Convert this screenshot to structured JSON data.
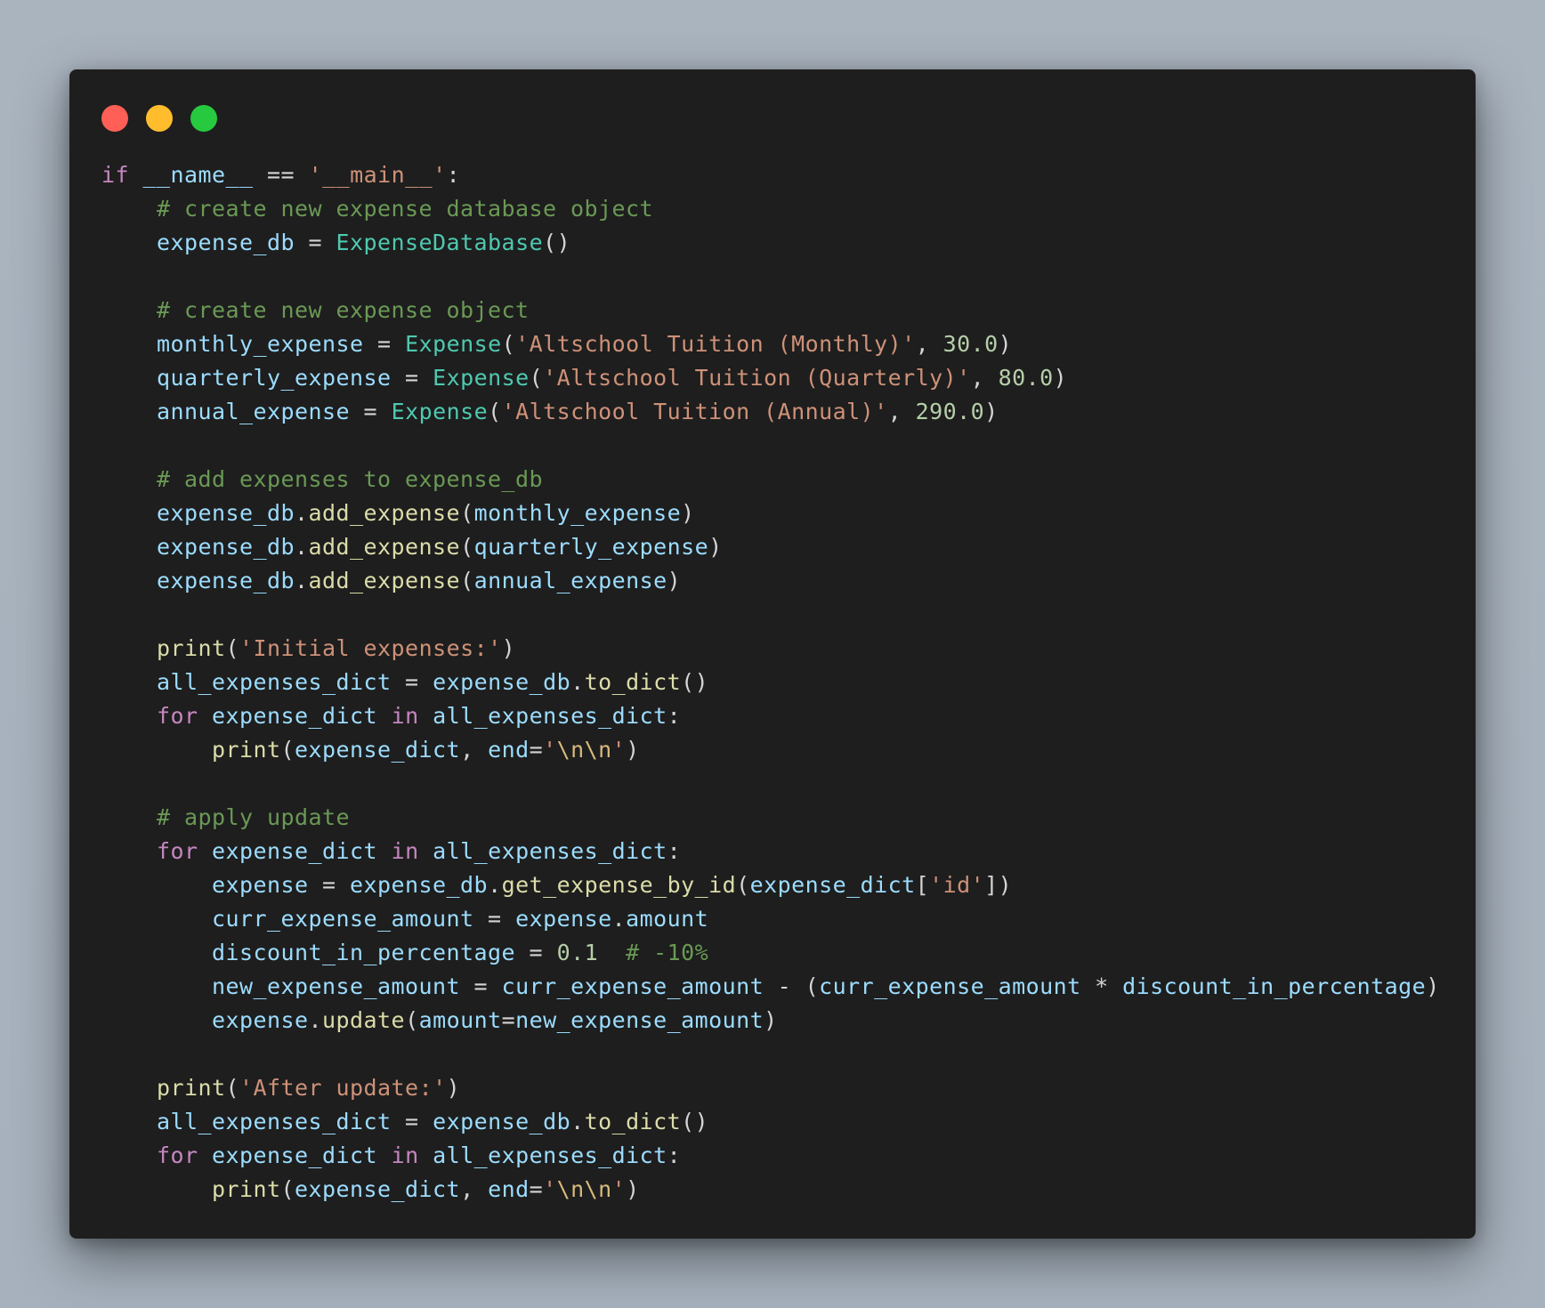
{
  "window": {
    "buttons": [
      {
        "name": "close",
        "color": "#ff5f56"
      },
      {
        "name": "minimize",
        "color": "#ffbd2e"
      },
      {
        "name": "maximize",
        "color": "#27c93f"
      }
    ]
  },
  "theme": {
    "background": "#1e1e1e",
    "keyword": "#c586c0",
    "variable": "#9cdcfe",
    "class": "#4ec9b0",
    "function": "#dcdcaa",
    "string": "#ce9178",
    "number": "#b5cea8",
    "comment": "#6a9955",
    "punctuation": "#d4d4d4"
  },
  "code": {
    "language": "python",
    "lines": [
      [
        [
          "kw",
          "if"
        ],
        [
          "pu",
          " "
        ],
        [
          "id",
          "__name__"
        ],
        [
          "pu",
          " == "
        ],
        [
          "str",
          "'__main__'"
        ],
        [
          "pu",
          ":"
        ]
      ],
      [
        [
          "ws",
          "    "
        ],
        [
          "cm",
          "# create new expense database object"
        ]
      ],
      [
        [
          "ws",
          "    "
        ],
        [
          "id",
          "expense_db"
        ],
        [
          "pu",
          " = "
        ],
        [
          "cls",
          "ExpenseDatabase"
        ],
        [
          "pu",
          "()"
        ]
      ],
      [],
      [
        [
          "ws",
          "    "
        ],
        [
          "cm",
          "# create new expense object"
        ]
      ],
      [
        [
          "ws",
          "    "
        ],
        [
          "id",
          "monthly_expense"
        ],
        [
          "pu",
          " = "
        ],
        [
          "cls",
          "Expense"
        ],
        [
          "pu",
          "("
        ],
        [
          "str",
          "'Altschool Tuition (Monthly)'"
        ],
        [
          "pu",
          ", "
        ],
        [
          "num",
          "30.0"
        ],
        [
          "pu",
          ")"
        ]
      ],
      [
        [
          "ws",
          "    "
        ],
        [
          "id",
          "quarterly_expense"
        ],
        [
          "pu",
          " = "
        ],
        [
          "cls",
          "Expense"
        ],
        [
          "pu",
          "("
        ],
        [
          "str",
          "'Altschool Tuition (Quarterly)'"
        ],
        [
          "pu",
          ", "
        ],
        [
          "num",
          "80.0"
        ],
        [
          "pu",
          ")"
        ]
      ],
      [
        [
          "ws",
          "    "
        ],
        [
          "id",
          "annual_expense"
        ],
        [
          "pu",
          " = "
        ],
        [
          "cls",
          "Expense"
        ],
        [
          "pu",
          "("
        ],
        [
          "str",
          "'Altschool Tuition (Annual)'"
        ],
        [
          "pu",
          ", "
        ],
        [
          "num",
          "290.0"
        ],
        [
          "pu",
          ")"
        ]
      ],
      [],
      [
        [
          "ws",
          "    "
        ],
        [
          "cm",
          "# add expenses to expense_db"
        ]
      ],
      [
        [
          "ws",
          "    "
        ],
        [
          "id",
          "expense_db"
        ],
        [
          "pu",
          "."
        ],
        [
          "fn",
          "add_expense"
        ],
        [
          "pu",
          "("
        ],
        [
          "id",
          "monthly_expense"
        ],
        [
          "pu",
          ")"
        ]
      ],
      [
        [
          "ws",
          "    "
        ],
        [
          "id",
          "expense_db"
        ],
        [
          "pu",
          "."
        ],
        [
          "fn",
          "add_expense"
        ],
        [
          "pu",
          "("
        ],
        [
          "id",
          "quarterly_expense"
        ],
        [
          "pu",
          ")"
        ]
      ],
      [
        [
          "ws",
          "    "
        ],
        [
          "id",
          "expense_db"
        ],
        [
          "pu",
          "."
        ],
        [
          "fn",
          "add_expense"
        ],
        [
          "pu",
          "("
        ],
        [
          "id",
          "annual_expense"
        ],
        [
          "pu",
          ")"
        ]
      ],
      [],
      [
        [
          "ws",
          "    "
        ],
        [
          "fn",
          "print"
        ],
        [
          "pu",
          "("
        ],
        [
          "str",
          "'Initial expenses:'"
        ],
        [
          "pu",
          ")"
        ]
      ],
      [
        [
          "ws",
          "    "
        ],
        [
          "id",
          "all_expenses_dict"
        ],
        [
          "pu",
          " = "
        ],
        [
          "id",
          "expense_db"
        ],
        [
          "pu",
          "."
        ],
        [
          "fn",
          "to_dict"
        ],
        [
          "pu",
          "()"
        ]
      ],
      [
        [
          "ws",
          "    "
        ],
        [
          "kw",
          "for"
        ],
        [
          "pu",
          " "
        ],
        [
          "id",
          "expense_dict"
        ],
        [
          "pu",
          " "
        ],
        [
          "kw",
          "in"
        ],
        [
          "pu",
          " "
        ],
        [
          "id",
          "all_expenses_dict"
        ],
        [
          "pu",
          ":"
        ]
      ],
      [
        [
          "ws",
          "        "
        ],
        [
          "fn",
          "print"
        ],
        [
          "pu",
          "("
        ],
        [
          "id",
          "expense_dict"
        ],
        [
          "pu",
          ", "
        ],
        [
          "id",
          "end"
        ],
        [
          "pu",
          "="
        ],
        [
          "str",
          "'"
        ],
        [
          "esc",
          "\\n\\n"
        ],
        [
          "str",
          "'"
        ],
        [
          "pu",
          ")"
        ]
      ],
      [],
      [
        [
          "ws",
          "    "
        ],
        [
          "cm",
          "# apply update"
        ]
      ],
      [
        [
          "ws",
          "    "
        ],
        [
          "kw",
          "for"
        ],
        [
          "pu",
          " "
        ],
        [
          "id",
          "expense_dict"
        ],
        [
          "pu",
          " "
        ],
        [
          "kw",
          "in"
        ],
        [
          "pu",
          " "
        ],
        [
          "id",
          "all_expenses_dict"
        ],
        [
          "pu",
          ":"
        ]
      ],
      [
        [
          "ws",
          "        "
        ],
        [
          "id",
          "expense"
        ],
        [
          "pu",
          " = "
        ],
        [
          "id",
          "expense_db"
        ],
        [
          "pu",
          "."
        ],
        [
          "fn",
          "get_expense_by_id"
        ],
        [
          "pu",
          "("
        ],
        [
          "id",
          "expense_dict"
        ],
        [
          "pu",
          "["
        ],
        [
          "str",
          "'id'"
        ],
        [
          "pu",
          "])"
        ]
      ],
      [
        [
          "ws",
          "        "
        ],
        [
          "id",
          "curr_expense_amount"
        ],
        [
          "pu",
          " = "
        ],
        [
          "id",
          "expense"
        ],
        [
          "pu",
          "."
        ],
        [
          "id",
          "amount"
        ]
      ],
      [
        [
          "ws",
          "        "
        ],
        [
          "id",
          "discount_in_percentage"
        ],
        [
          "pu",
          " = "
        ],
        [
          "num",
          "0.1"
        ],
        [
          "pu",
          "  "
        ],
        [
          "cm",
          "# -10%"
        ]
      ],
      [
        [
          "ws",
          "        "
        ],
        [
          "id",
          "new_expense_amount"
        ],
        [
          "pu",
          " = "
        ],
        [
          "id",
          "curr_expense_amount"
        ],
        [
          "pu",
          " - ("
        ],
        [
          "id",
          "curr_expense_amount"
        ],
        [
          "pu",
          " * "
        ],
        [
          "id",
          "discount_in_percentage"
        ],
        [
          "pu",
          ")"
        ]
      ],
      [
        [
          "ws",
          "        "
        ],
        [
          "id",
          "expense"
        ],
        [
          "pu",
          "."
        ],
        [
          "fn",
          "update"
        ],
        [
          "pu",
          "("
        ],
        [
          "id",
          "amount"
        ],
        [
          "pu",
          "="
        ],
        [
          "id",
          "new_expense_amount"
        ],
        [
          "pu",
          ")"
        ]
      ],
      [],
      [
        [
          "ws",
          "    "
        ],
        [
          "fn",
          "print"
        ],
        [
          "pu",
          "("
        ],
        [
          "str",
          "'After update:'"
        ],
        [
          "pu",
          ")"
        ]
      ],
      [
        [
          "ws",
          "    "
        ],
        [
          "id",
          "all_expenses_dict"
        ],
        [
          "pu",
          " = "
        ],
        [
          "id",
          "expense_db"
        ],
        [
          "pu",
          "."
        ],
        [
          "fn",
          "to_dict"
        ],
        [
          "pu",
          "()"
        ]
      ],
      [
        [
          "ws",
          "    "
        ],
        [
          "kw",
          "for"
        ],
        [
          "pu",
          " "
        ],
        [
          "id",
          "expense_dict"
        ],
        [
          "pu",
          " "
        ],
        [
          "kw",
          "in"
        ],
        [
          "pu",
          " "
        ],
        [
          "id",
          "all_expenses_dict"
        ],
        [
          "pu",
          ":"
        ]
      ],
      [
        [
          "ws",
          "        "
        ],
        [
          "fn",
          "print"
        ],
        [
          "pu",
          "("
        ],
        [
          "id",
          "expense_dict"
        ],
        [
          "pu",
          ", "
        ],
        [
          "id",
          "end"
        ],
        [
          "pu",
          "="
        ],
        [
          "str",
          "'"
        ],
        [
          "esc",
          "\\n\\n"
        ],
        [
          "str",
          "'"
        ],
        [
          "pu",
          ")"
        ]
      ]
    ]
  }
}
